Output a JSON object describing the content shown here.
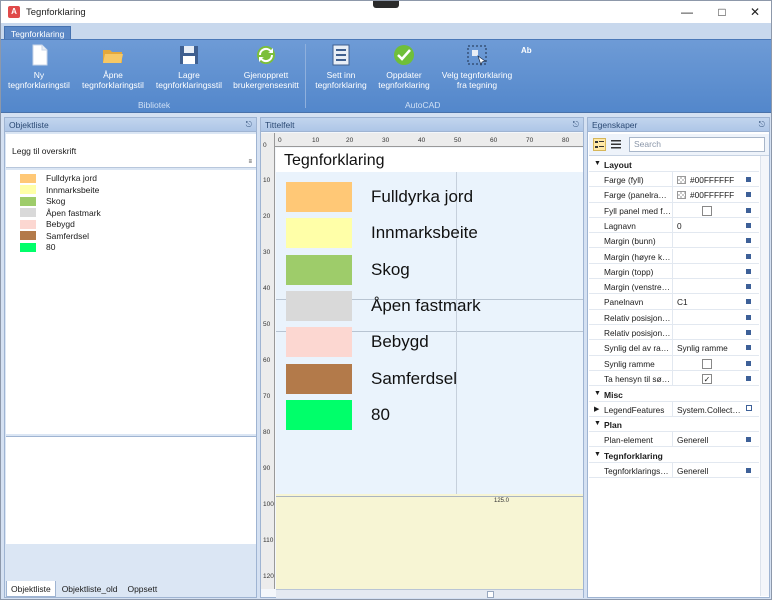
{
  "window": {
    "title": "Tegnforklaring",
    "app_icon": "autocad-a-icon"
  },
  "ribbon": {
    "tab": "Tegnforklaring",
    "groups": [
      {
        "label": "Bibliotek"
      },
      {
        "label": "AutoCAD"
      }
    ],
    "buttons": [
      {
        "label1": "Ny",
        "label2": "tegnforklaringstil",
        "icon": "new-document-icon"
      },
      {
        "label1": "Åpne",
        "label2": "tegnforklaringstil",
        "icon": "open-folder-icon"
      },
      {
        "label1": "Lagre",
        "label2": "tegnforklaringsstil",
        "icon": "save-disk-icon"
      },
      {
        "label1": "Gjenopprett",
        "label2": "brukergrensesnitt",
        "icon": "refresh-icon"
      },
      {
        "label1": "Sett inn",
        "label2": "tegnforklaring",
        "icon": "insert-list-icon"
      },
      {
        "label1": "Oppdater",
        "label2": "tegnforklaring",
        "icon": "check-circle-icon"
      },
      {
        "label1": "Velg tegnforklaring",
        "label2": "fra tegning",
        "icon": "select-region-icon"
      }
    ]
  },
  "object_list": {
    "title": "Objektliste",
    "heading_placeholder": "Legg til overskrift",
    "items": [
      {
        "label": "Fulldyrka jord",
        "color": "#FFC876"
      },
      {
        "label": "Innmarksbeite",
        "color": "#FFFFA8"
      },
      {
        "label": "Skog",
        "color": "#9ECC6A"
      },
      {
        "label": "Åpen fastmark",
        "color": "#D9D9D9"
      },
      {
        "label": "Bebygd",
        "color": "#FCD7D1"
      },
      {
        "label": "Samferdsel",
        "color": "#B37A4A"
      },
      {
        "label": "80",
        "color": "#00FF6A"
      }
    ],
    "tabs": [
      "Objektliste",
      "Objektliste_old",
      "Oppsett"
    ]
  },
  "title_field": {
    "title": "Tittelfelt",
    "canvas_title": "Tegnforklaring",
    "ruler_top": [
      "0",
      "10",
      "20",
      "30",
      "40",
      "50",
      "60",
      "70",
      "80"
    ],
    "ruler_left": [
      "0",
      "10",
      "20",
      "30",
      "40",
      "50",
      "60",
      "70",
      "80",
      "90",
      "100",
      "110",
      "120"
    ],
    "dimension_label": "125.0"
  },
  "properties": {
    "title": "Egenskaper",
    "search_placeholder": "Search",
    "categories": [
      {
        "name": "Layout",
        "rows": [
          {
            "name": "Farge (fyll)",
            "value": "#00FFFFFF",
            "kind": "color"
          },
          {
            "name": "Farge (panelra…",
            "value": "#00FFFFFF",
            "kind": "color"
          },
          {
            "name": "Fyll panel med f…",
            "value": "",
            "kind": "checkbox",
            "checked": false
          },
          {
            "name": "Lagnavn",
            "value": "0",
            "kind": "text"
          },
          {
            "name": "Margin (bunn)",
            "value": "",
            "kind": "text"
          },
          {
            "name": "Margin (høyre k…",
            "value": "",
            "kind": "text"
          },
          {
            "name": "Margin (topp)",
            "value": "",
            "kind": "text"
          },
          {
            "name": "Margin (venstre…",
            "value": "",
            "kind": "text"
          },
          {
            "name": "Panelnavn",
            "value": "C1",
            "kind": "text"
          },
          {
            "name": "Relativ posisjon…",
            "value": "",
            "kind": "text"
          },
          {
            "name": "Relativ posisjon…",
            "value": "",
            "kind": "text"
          },
          {
            "name": "Synlig del av ra…",
            "value": "Synlig ramme",
            "kind": "text"
          },
          {
            "name": "Synlig ramme",
            "value": "",
            "kind": "checkbox",
            "checked": false
          },
          {
            "name": "Ta hensyn til sø…",
            "value": "",
            "kind": "checkbox",
            "checked": true
          }
        ]
      },
      {
        "name": "Misc",
        "rows": [
          {
            "name": "LegendFeatures",
            "value": "System.Collect…",
            "kind": "collection"
          }
        ]
      },
      {
        "name": "Plan",
        "rows": [
          {
            "name": "Plan-element",
            "value": "Generell",
            "kind": "text"
          }
        ]
      },
      {
        "name": "Tegnforklaring",
        "rows": [
          {
            "name": "Tegnforklarings…",
            "value": "Generell",
            "kind": "text"
          }
        ]
      }
    ]
  }
}
